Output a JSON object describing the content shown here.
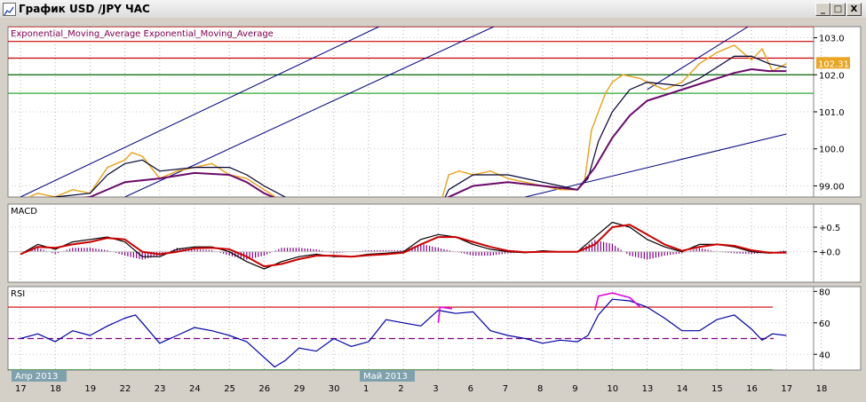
{
  "window": {
    "title": "График USD /JPY  ЧАС",
    "buttons": {
      "minimize": "_",
      "maximize": "□",
      "close": "X"
    }
  },
  "chart_data": [
    {
      "type": "line",
      "panel": "price",
      "title": "Exponential_Moving_Average Exponential_Moving_Average",
      "ylim": [
        98.7,
        103.3
      ],
      "y_ticks": [
        "103.0",
        "102.0",
        "101.0",
        "100.0",
        "99.00"
      ],
      "y_tick_values": [
        103.0,
        102.0,
        101.0,
        100.0,
        99.0
      ],
      "current_price_label": "102.31",
      "current_price": 102.31,
      "horizontal_lines": [
        {
          "y": 103.3,
          "color": "#cc0000"
        },
        {
          "y": 102.9,
          "color": "#cc0000"
        },
        {
          "y": 102.45,
          "color": "#cc0000"
        },
        {
          "y": 102.0,
          "color": "#006600"
        },
        {
          "y": 101.5,
          "color": "#33aa33"
        }
      ],
      "x_day_index": [
        17,
        18,
        19,
        22,
        23,
        24,
        25,
        26,
        29,
        30,
        1,
        2,
        3,
        6,
        7,
        8,
        9,
        10,
        13,
        14,
        15,
        16,
        17,
        18
      ],
      "x_tick_labels": [
        "17",
        "18",
        "19",
        "22",
        "23",
        "24",
        "25",
        "26",
        "29",
        "30",
        "1",
        "2",
        "3",
        "6",
        "7",
        "8",
        "9",
        "10",
        "13",
        "14",
        "15",
        "16",
        "17",
        "18"
      ],
      "series": [
        {
          "role": "price",
          "color": "#e8a623",
          "x": [
            0,
            0.5,
            1,
            1.5,
            2,
            2.5,
            3,
            3.2,
            3.5,
            4,
            4.5,
            5,
            5.5,
            6,
            6.5,
            7,
            7.5,
            8,
            8.5,
            9,
            9.5,
            10,
            10.5,
            11,
            11.5,
            12,
            12.3,
            12.6,
            13,
            13.5,
            14,
            14.5,
            15,
            15.5,
            16,
            16.2,
            16.4,
            16.8,
            17,
            17.3,
            17.8,
            18,
            18.5,
            19,
            19.5,
            20,
            20.5,
            21,
            21.3,
            21.6,
            22
          ],
          "y": [
            98.6,
            98.8,
            98.7,
            98.9,
            98.8,
            99.5,
            99.7,
            99.9,
            99.8,
            99.2,
            99.4,
            99.5,
            99.6,
            99.3,
            99.2,
            98.9,
            98.6,
            98.4,
            98.3,
            98.2,
            98.3,
            98.5,
            98.4,
            98.3,
            98.4,
            98.3,
            99.3,
            99.4,
            99.3,
            99.4,
            99.2,
            99.1,
            99.0,
            98.9,
            98.9,
            99.1,
            100.5,
            101.5,
            101.8,
            102.0,
            101.9,
            101.8,
            101.6,
            101.8,
            102.3,
            102.6,
            102.8,
            102.4,
            102.7,
            102.1,
            102.3
          ]
        },
        {
          "role": "ema_fast",
          "color": "#000033",
          "x": [
            0,
            1,
            2,
            2.5,
            3,
            3.5,
            4,
            5,
            6,
            6.5,
            7,
            8,
            9,
            10,
            11,
            12,
            12.3,
            13,
            14,
            15,
            15.5,
            16,
            16.3,
            16.6,
            17,
            17.5,
            18,
            19,
            19.5,
            20,
            20.5,
            21,
            21.5,
            22
          ],
          "y": [
            98.6,
            98.7,
            98.8,
            99.3,
            99.6,
            99.7,
            99.4,
            99.5,
            99.5,
            99.3,
            99.0,
            98.5,
            98.3,
            98.4,
            98.4,
            98.3,
            98.9,
            99.3,
            99.3,
            99.1,
            99.0,
            98.9,
            99.2,
            100.2,
            101.0,
            101.6,
            101.8,
            101.7,
            101.9,
            102.2,
            102.5,
            102.5,
            102.3,
            102.2
          ]
        },
        {
          "role": "ema_slow",
          "color": "#6a0a6a",
          "x": [
            0,
            1,
            2,
            3,
            4,
            5,
            6,
            6.5,
            7,
            8,
            9,
            10,
            11,
            12,
            12.3,
            13,
            14,
            15,
            15.5,
            16,
            16.5,
            17,
            17.5,
            18,
            19,
            20,
            20.5,
            21,
            21.5,
            22
          ],
          "y": [
            98.5,
            98.6,
            98.7,
            99.1,
            99.2,
            99.35,
            99.3,
            99.1,
            98.8,
            98.4,
            98.2,
            98.3,
            98.3,
            98.3,
            98.7,
            99.0,
            99.1,
            99.0,
            98.95,
            98.9,
            99.5,
            100.3,
            100.9,
            101.3,
            101.6,
            101.9,
            102.05,
            102.15,
            102.1,
            102.1
          ]
        }
      ],
      "trendlines": [
        {
          "x": [
            0,
            10.3
          ],
          "y": [
            98.7,
            103.3
          ],
          "color": "#000080"
        },
        {
          "x": [
            3.0,
            13.6
          ],
          "y": [
            98.7,
            103.3
          ],
          "color": "#000080"
        },
        {
          "x": [
            14.5,
            22
          ],
          "y": [
            98.7,
            100.4
          ],
          "color": "#000080"
        },
        {
          "x": [
            18,
            20.9
          ],
          "y": [
            101.6,
            103.3
          ],
          "color": "#000080"
        }
      ]
    },
    {
      "type": "line",
      "panel": "macd",
      "title": "MACD",
      "ylim": [
        -0.62,
        0.97
      ],
      "y_ticks": [
        "+0.5",
        "+0.0"
      ],
      "y_tick_values": [
        0.5,
        0.0
      ],
      "series": [
        {
          "role": "macd",
          "color": "#000000",
          "x": [
            0,
            0.5,
            1,
            1.5,
            2,
            2.5,
            3,
            3.5,
            4,
            4.5,
            5,
            5.5,
            6,
            6.5,
            7,
            7.5,
            8,
            8.5,
            9,
            9.5,
            10,
            10.5,
            11,
            11.5,
            12,
            12.5,
            13,
            13.5,
            14,
            14.5,
            15,
            15.5,
            16,
            16.5,
            17,
            17.5,
            18,
            18.5,
            19,
            19.5,
            20,
            20.5,
            21,
            21.5,
            22
          ],
          "y": [
            -0.05,
            0.15,
            0.05,
            0.2,
            0.25,
            0.3,
            0.2,
            -0.1,
            -0.1,
            0.05,
            0.1,
            0.1,
            0.0,
            -0.2,
            -0.35,
            -0.2,
            -0.1,
            -0.05,
            -0.1,
            -0.1,
            -0.05,
            -0.03,
            0.0,
            0.25,
            0.35,
            0.3,
            0.15,
            0.05,
            0.0,
            -0.02,
            0.02,
            0.0,
            0.0,
            0.3,
            0.6,
            0.5,
            0.25,
            0.1,
            0.0,
            0.15,
            0.15,
            0.1,
            0.0,
            -0.03,
            0.0
          ]
        },
        {
          "role": "signal",
          "color": "#cc0000",
          "x": [
            0,
            0.5,
            1,
            1.5,
            2,
            2.5,
            3,
            3.5,
            4,
            4.5,
            5,
            5.5,
            6,
            6.5,
            7,
            7.5,
            8,
            8.5,
            9,
            9.5,
            10,
            10.5,
            11,
            11.5,
            12,
            12.5,
            13,
            13.5,
            14,
            14.5,
            15,
            15.5,
            16,
            16.5,
            17,
            17.5,
            18,
            18.5,
            19,
            19.5,
            20,
            20.5,
            21,
            21.5,
            22
          ],
          "y": [
            -0.05,
            0.1,
            0.08,
            0.15,
            0.2,
            0.28,
            0.25,
            0.0,
            -0.05,
            0.0,
            0.07,
            0.08,
            0.05,
            -0.1,
            -0.3,
            -0.25,
            -0.15,
            -0.08,
            -0.08,
            -0.1,
            -0.07,
            -0.05,
            -0.02,
            0.15,
            0.3,
            0.3,
            0.2,
            0.1,
            0.02,
            -0.01,
            0.0,
            0.0,
            0.0,
            0.15,
            0.5,
            0.55,
            0.35,
            0.15,
            0.02,
            0.1,
            0.15,
            0.12,
            0.03,
            -0.02,
            -0.02
          ]
        }
      ]
    },
    {
      "type": "line",
      "panel": "rsi",
      "title": "RSI",
      "ylim": [
        30,
        83
      ],
      "y_ticks": [
        "80",
        "60",
        "40"
      ],
      "y_tick_values": [
        80,
        60,
        40
      ],
      "horizontal_lines": [
        {
          "y": 70,
          "color": "#cc0000",
          "style": "solid"
        },
        {
          "y": 50,
          "color": "#800080",
          "style": "dashed"
        },
        {
          "y": 30,
          "color": "#006600",
          "style": "solid"
        }
      ],
      "series": [
        {
          "role": "rsi",
          "color": "#0000aa",
          "x": [
            0,
            0.5,
            1,
            1.5,
            2,
            2.5,
            3,
            3.3,
            3.5,
            4,
            4.5,
            5,
            5.5,
            6,
            6.5,
            7,
            7.3,
            7.6,
            8,
            8.5,
            9,
            9.5,
            10,
            10.5,
            11,
            11.5,
            12,
            12.5,
            13,
            13.5,
            14,
            14.5,
            15,
            15.5,
            16,
            16.3,
            16.6,
            17,
            17.5,
            18,
            18.5,
            19,
            19.5,
            20,
            20.5,
            21,
            21.3,
            21.6,
            22
          ],
          "y": [
            50,
            53,
            48,
            55,
            52,
            58,
            63,
            65,
            60,
            47,
            52,
            57,
            55,
            52,
            48,
            38,
            32,
            36,
            44,
            42,
            50,
            45,
            48,
            62,
            60,
            58,
            68,
            66,
            67,
            55,
            52,
            50,
            47,
            49,
            48,
            52,
            65,
            75,
            74,
            70,
            63,
            55,
            55,
            62,
            65,
            56,
            49,
            53,
            52
          ]
        },
        {
          "role": "rsi_overbought",
          "color": "#e000e0",
          "x": [
            12.0,
            12.05,
            12.4
          ],
          "y": [
            60,
            70,
            69
          ]
        },
        {
          "role": "rsi_overbought_2",
          "color": "#e000e0",
          "x": [
            16.5,
            16.6,
            17,
            17.5,
            17.8
          ],
          "y": [
            68,
            77,
            79,
            76,
            70
          ]
        }
      ]
    }
  ],
  "time_axis": {
    "month_labels": [
      "Апр 2013",
      "Май 2013"
    ],
    "month_positions_index": [
      0,
      10
    ]
  }
}
